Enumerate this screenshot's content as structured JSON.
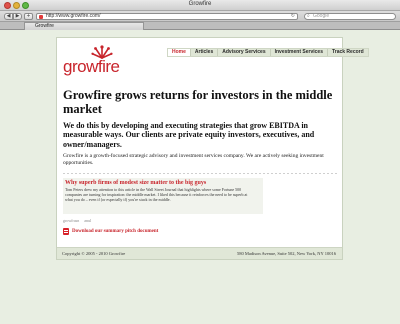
{
  "window": {
    "title": "Growfire"
  },
  "toolbar": {
    "back_label": "◀",
    "forward_label": "▶",
    "add_label": "+",
    "url": "http://www.growfire.com/",
    "reload_label": "↻",
    "search_placeholder": "Google",
    "search_icon": "⌕"
  },
  "tabs": [
    {
      "label": "Growfire"
    }
  ],
  "site": {
    "logo_text": "growfire",
    "accent_color": "#c8252c",
    "nav": [
      {
        "label": "Home",
        "active": true
      },
      {
        "label": "Articles",
        "active": false
      },
      {
        "label": "Advisory Services",
        "active": false
      },
      {
        "label": "Investment Services",
        "active": false
      },
      {
        "label": "Track Record",
        "active": false
      }
    ],
    "headline": "Growfire grows returns for investors in the middle market",
    "subhead": "We do this by developing and executing strategies that grow EBITDA in measurable ways. Our clients are private equity investors, executives, and owner/managers.",
    "body": "Growfire is a growth-focused strategic advisory and investment services company. We are actively seeking investment opportunities.",
    "article": {
      "title": "Why superb firms of modest size matter to the big guys",
      "body": "Tom Peters drew my attention to this article in the Wall Street Journal that highlights where some Fortune 500 companies are turning for inspiration: the middle market. I liked this because it reinforces the need to be superb at what you do – even if (or especially if) you're stuck in the middle."
    },
    "tags": [
      "growfrasn",
      "anul"
    ],
    "download_label": "Download our summary pitch document",
    "footer": {
      "copyright": "Copyright © 2005 - 2010 Growfire",
      "address": "580 Madison Avenue, Suite 502, New York, NY 10016"
    }
  }
}
